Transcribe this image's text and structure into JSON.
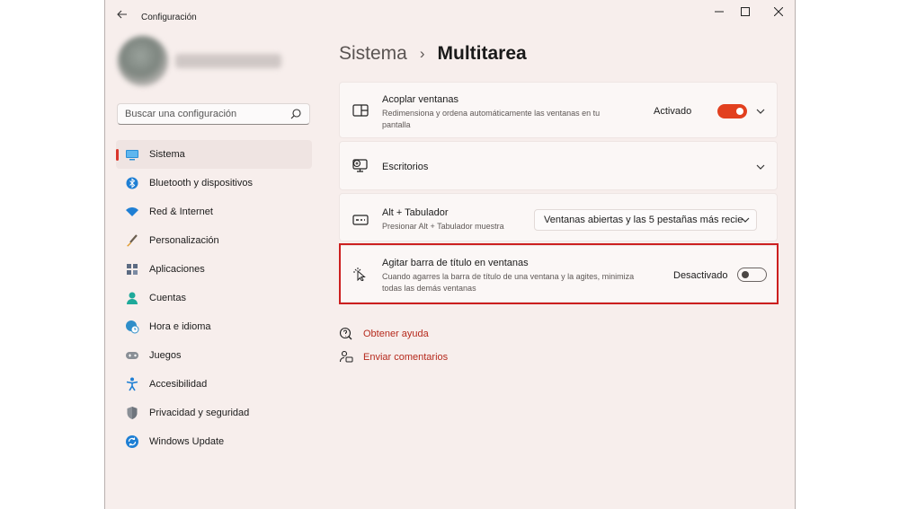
{
  "window": {
    "title": "Configuración"
  },
  "search": {
    "placeholder": "Buscar una configuración"
  },
  "sidebar": {
    "items": [
      {
        "label": "Sistema",
        "icon": "monitor-icon",
        "active": true
      },
      {
        "label": "Bluetooth y dispositivos",
        "icon": "bluetooth-icon"
      },
      {
        "label": "Red & Internet",
        "icon": "wifi-icon"
      },
      {
        "label": "Personalización",
        "icon": "brush-icon"
      },
      {
        "label": "Aplicaciones",
        "icon": "apps-icon"
      },
      {
        "label": "Cuentas",
        "icon": "person-icon"
      },
      {
        "label": "Hora e idioma",
        "icon": "globe-clock-icon"
      },
      {
        "label": "Juegos",
        "icon": "gamepad-icon"
      },
      {
        "label": "Accesibilidad",
        "icon": "accessibility-icon"
      },
      {
        "label": "Privacidad y seguridad",
        "icon": "shield-icon"
      },
      {
        "label": "Windows Update",
        "icon": "update-icon"
      }
    ]
  },
  "breadcrumb": {
    "parent": "Sistema",
    "separator": "›",
    "current": "Multitarea"
  },
  "settings": {
    "snap": {
      "title": "Acoplar ventanas",
      "description": "Redimensiona y ordena automáticamente las ventanas en tu pantalla",
      "state": "Activado",
      "enabled": true
    },
    "desktops": {
      "title": "Escritorios"
    },
    "alttab": {
      "title": "Alt + Tabulador",
      "description": "Presionar Alt + Tabulador muestra",
      "value": "Ventanas abiertas y las 5 pestañas más recie"
    },
    "shake": {
      "title": "Agitar barra de título en ventanas",
      "description": "Cuando agarres la barra de título de una ventana y la agites, minimiza todas las demás ventanas",
      "state": "Desactivado",
      "enabled": false
    }
  },
  "links": {
    "help": "Obtener ayuda",
    "feedback": "Enviar comentarios"
  },
  "colors": {
    "accent": "#e2401f",
    "highlight": "#cc1f1f",
    "link": "#b62a1d",
    "window_bg": "#f7eeec"
  }
}
